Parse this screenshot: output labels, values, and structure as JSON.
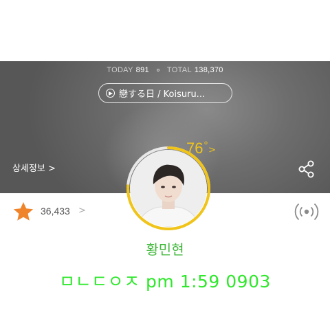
{
  "stats": {
    "today_label": "TODAY",
    "today_value": "891",
    "total_label": "TOTAL",
    "total_value": "138,370"
  },
  "song": {
    "title": "戀する日 / Koisuru..."
  },
  "detail_link": {
    "label": "상세정보 >"
  },
  "temperature": {
    "value": "76",
    "unit": "°",
    "chevron": ">",
    "fraction": 0.76,
    "color": "#f0c419"
  },
  "fans": {
    "count": "36,433",
    "chevron": ">",
    "icon": "star-icon",
    "color": "#f0842a"
  },
  "artist": {
    "name": "황민현",
    "color": "#41b83b"
  },
  "caption": {
    "text": "ㅁㄴㄷㅇㅈ pm 1:59 0903",
    "color": "#2ee82b"
  },
  "icons": {
    "play": "play-icon",
    "share": "share-icon",
    "broadcast": "broadcast-icon"
  }
}
